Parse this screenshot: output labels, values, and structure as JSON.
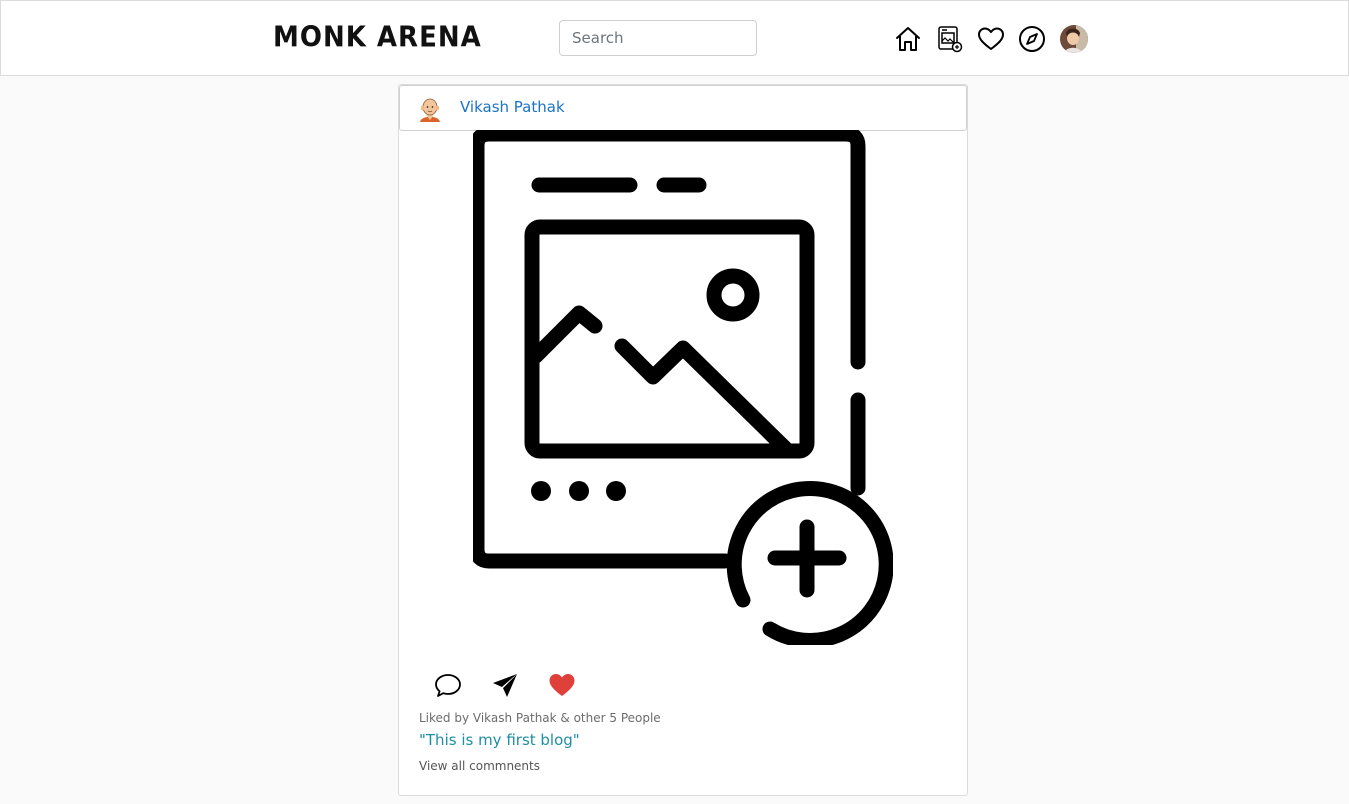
{
  "app": {
    "logo_text": "MONK ARENA"
  },
  "search": {
    "placeholder": "Search",
    "value": ""
  },
  "nav": {
    "icons": [
      "home-icon",
      "new-post-icon",
      "heart-icon",
      "explore-compass-icon",
      "profile-avatar"
    ]
  },
  "post": {
    "username": "Vikash Pathak",
    "likes_text": "Liked by Vikash Pathak & other 5 People",
    "caption": "\"This is my first blog\"",
    "view_comments": "View all commnents",
    "liked": true,
    "like_color": "#e0403a"
  },
  "colors": {
    "username_link": "#1a73c8",
    "caption": "#1f8fa3",
    "background": "#fafafa"
  }
}
